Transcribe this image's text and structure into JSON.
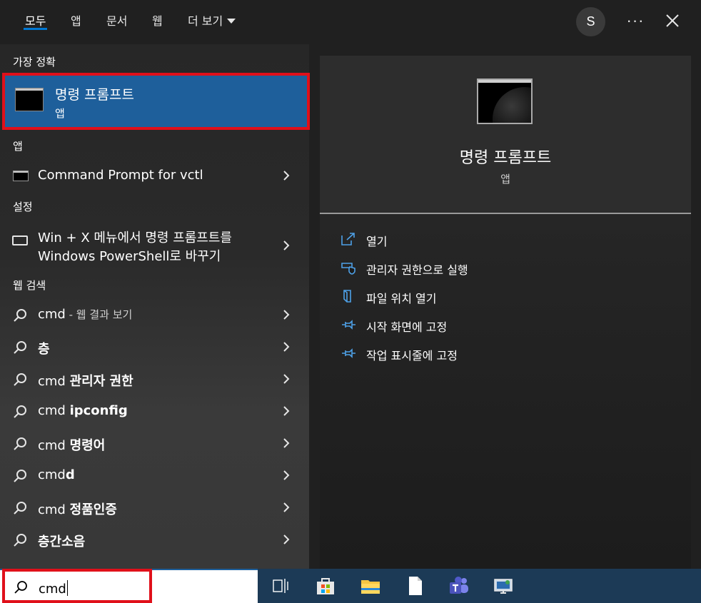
{
  "tabs": [
    {
      "label": "모두"
    },
    {
      "label": "앱"
    },
    {
      "label": "문서"
    },
    {
      "label": "웹"
    },
    {
      "label": "더 보기"
    }
  ],
  "user": {
    "initial": "S"
  },
  "header_icons": {
    "more": "more-icon",
    "close": "close-icon"
  },
  "best_match": {
    "section": "가장 정확",
    "title": "명령 프롬프트",
    "subtitle": "앱"
  },
  "apps": {
    "section": "앱",
    "items": [
      {
        "label": "Command Prompt for vctl"
      }
    ]
  },
  "settings": {
    "section": "설정",
    "items": [
      {
        "line1": "Win + X 메뉴에서 명령 프롬프트를",
        "line2": "Windows PowerShell로 바꾸기"
      }
    ]
  },
  "web": {
    "section": "웹 검색",
    "first": {
      "query": "cmd",
      "suffix": " - 웹 결과 보기"
    },
    "items": [
      {
        "plain": "",
        "bold": "층"
      },
      {
        "plain": "cmd ",
        "bold": "관리자 권한"
      },
      {
        "plain": "cmd ",
        "bold": "ipconfig"
      },
      {
        "plain": "cmd ",
        "bold": "명령어"
      },
      {
        "plain": "cmd",
        "bold": "d"
      },
      {
        "plain": "cmd ",
        "bold": "정품인증"
      },
      {
        "plain": "",
        "bold": "층간소음"
      }
    ]
  },
  "detail": {
    "title": "명령 프롬프트",
    "subtitle": "앱",
    "actions": [
      {
        "label": "열기",
        "icon": "open-icon"
      },
      {
        "label": "관리자 권한으로 실행",
        "icon": "shield-icon"
      },
      {
        "label": "파일 위치 열기",
        "icon": "file-location-icon"
      },
      {
        "label": "시작 화면에 고정",
        "icon": "pin-icon"
      },
      {
        "label": "작업 표시줄에 고정",
        "icon": "pin-icon"
      }
    ]
  },
  "search": {
    "value": "cmd"
  },
  "taskbar": {
    "icons": [
      "task-view-icon",
      "store-icon",
      "file-explorer-icon",
      "file-icon",
      "teams-icon",
      "remote-desktop-icon"
    ]
  },
  "colors": {
    "accent": "#0078d4",
    "selection": "#1e5f9b",
    "highlight_border": "#e0101a",
    "taskbar": "#1c3a56"
  }
}
